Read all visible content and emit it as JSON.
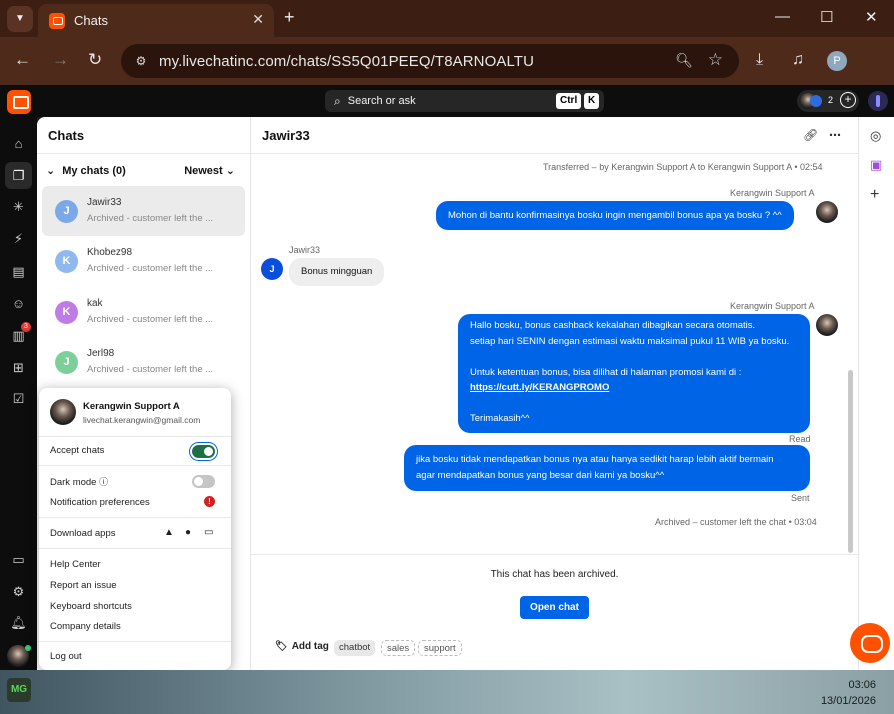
{
  "browser": {
    "tab_title": "Chats",
    "url": "my.livechatinc.com/chats/SS5Q01PEEQ/T8ARNOALTU",
    "profile_initial": "P"
  },
  "topbar": {
    "search_label": "Search or ask",
    "kbd_ctrl": "Ctrl",
    "kbd_k": "K",
    "agents_count": "2"
  },
  "sidebar": {
    "reports_badge": "3"
  },
  "chats_panel": {
    "title": "Chats",
    "filter_label": "My chats (0)",
    "sort_label": "Newest",
    "items": [
      {
        "initial": "J",
        "name": "Jawir33",
        "preview": "Archived - customer left the ...",
        "color": "#7aa8e8"
      },
      {
        "initial": "K",
        "name": "Khobez98",
        "preview": "Archived - customer left the ...",
        "color": "#8fb8ef"
      },
      {
        "initial": "K",
        "name": "kak",
        "preview": "Archived - customer left the ...",
        "color": "#c07be6"
      },
      {
        "initial": "J",
        "name": "Jerl98",
        "preview": "Archived - customer left the ...",
        "color": "#7dcf9a"
      }
    ]
  },
  "conversation": {
    "title": "Jawir33",
    "transfer_note": "Transferred – by Kerangwin Support A to Kerangwin Support A • 02:54",
    "agent_name": "Kerangwin Support A",
    "customer_name": "Jawir33",
    "customer_initial": "J",
    "messages": [
      {
        "from": "agent",
        "text": "Mohon di bantu konfirmasinya bosku ingin mengambil bonus apa ya bosku ? ^^"
      },
      {
        "from": "customer",
        "text": "Bonus mingguan"
      },
      {
        "from": "agent",
        "lines": [
          "Hallo bosku, bonus cashback kekalahan dibagikan secara otomatis.",
          "setiap hari SENIN dengan estimasi waktu maksimal pukul 11 WIB ya bosku.",
          "",
          "Untuk ketentuan bonus, bisa dilihat di halaman promosi kami di :",
          "https://cutt.ly/KERANGPROMO",
          "",
          "Terimakasih^^"
        ]
      },
      {
        "from": "agent",
        "lines": [
          "jika bosku tidak mendapatkan bonus nya atau hanya sedikit harap lebih aktif bermain",
          "agar mendapatkan bonus yang besar dari kami ya bosku^^"
        ]
      }
    ],
    "status_read": "Read",
    "status_sent": "Sent",
    "end_note": "Archived – customer left the chat • 03:04",
    "archived_text": "This chat has been archived.",
    "open_button": "Open chat",
    "add_tag": "Add tag",
    "tags": [
      "chatbot",
      "sales",
      "support"
    ]
  },
  "profile_menu": {
    "name": "Kerangwin Support A",
    "email": "livechat.kerangwin@gmail.com",
    "accept_chats": "Accept chats",
    "accept_chats_on": true,
    "dark_mode": "Dark mode",
    "dark_mode_on": false,
    "notification_prefs": "Notification preferences",
    "download_apps": "Download apps",
    "help_center": "Help Center",
    "report_issue": "Report an issue",
    "shortcuts": "Keyboard shortcuts",
    "company": "Company details",
    "logout": "Log out"
  },
  "taskbar": {
    "app_icon_label": "MG",
    "time": "03:06",
    "date": "13/01/2026"
  }
}
